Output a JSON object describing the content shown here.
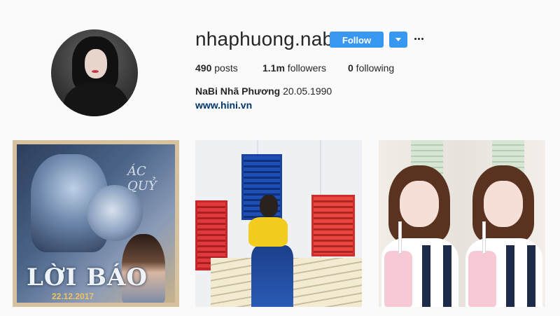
{
  "profile": {
    "username": "nhaphuong.nabi",
    "follow_label": "Follow",
    "stats": {
      "posts_count": "490",
      "posts_label": " posts",
      "followers_count": "1.1m",
      "followers_label": " followers",
      "following_count": "0",
      "following_label": " following"
    },
    "full_name": "NaBi Nhã Phương",
    "bio": "20.05.1990",
    "website": "www.hini.vn"
  },
  "posts": [
    {
      "title_text": "LỜI BÁO",
      "date_text": "22.12.2017",
      "tag_text": "ÁC QUỶ"
    },
    {},
    {}
  ],
  "colors": {
    "accent": "#3897f0",
    "link": "#003569",
    "background": "#fafafa",
    "text": "#262626"
  },
  "icons": {
    "dropdown": "chevron-down-icon",
    "more": "more-options-icon"
  }
}
